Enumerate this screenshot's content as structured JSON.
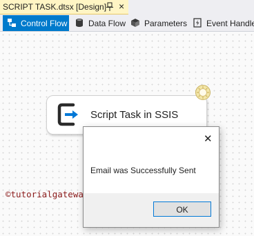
{
  "document_tab": {
    "title": "SCRIPT TASK.dtsx [Design]",
    "pin_icon": "pin-icon",
    "close_glyph": "×"
  },
  "designer_tabs": [
    {
      "label": "Control Flow",
      "icon": "control-flow-icon",
      "active": true
    },
    {
      "label": "Data Flow",
      "icon": "data-flow-icon",
      "active": false
    },
    {
      "label": "Parameters",
      "icon": "parameters-icon",
      "active": false
    },
    {
      "label": "Event Handler",
      "icon": "event-handler-icon",
      "active": false
    }
  ],
  "canvas": {
    "task": {
      "label": "Script Task in SSIS",
      "icon": "script-task-icon",
      "status_icon": "executing-status-icon"
    },
    "watermark": "©tutorialgateway.org"
  },
  "message_box": {
    "close_glyph": "✕",
    "message": "Email was Successfully Sent",
    "ok_label": "OK"
  },
  "colors": {
    "accent": "#007acc",
    "doc_tab": "#fff5c4",
    "watermark": "#8b1a1a"
  }
}
